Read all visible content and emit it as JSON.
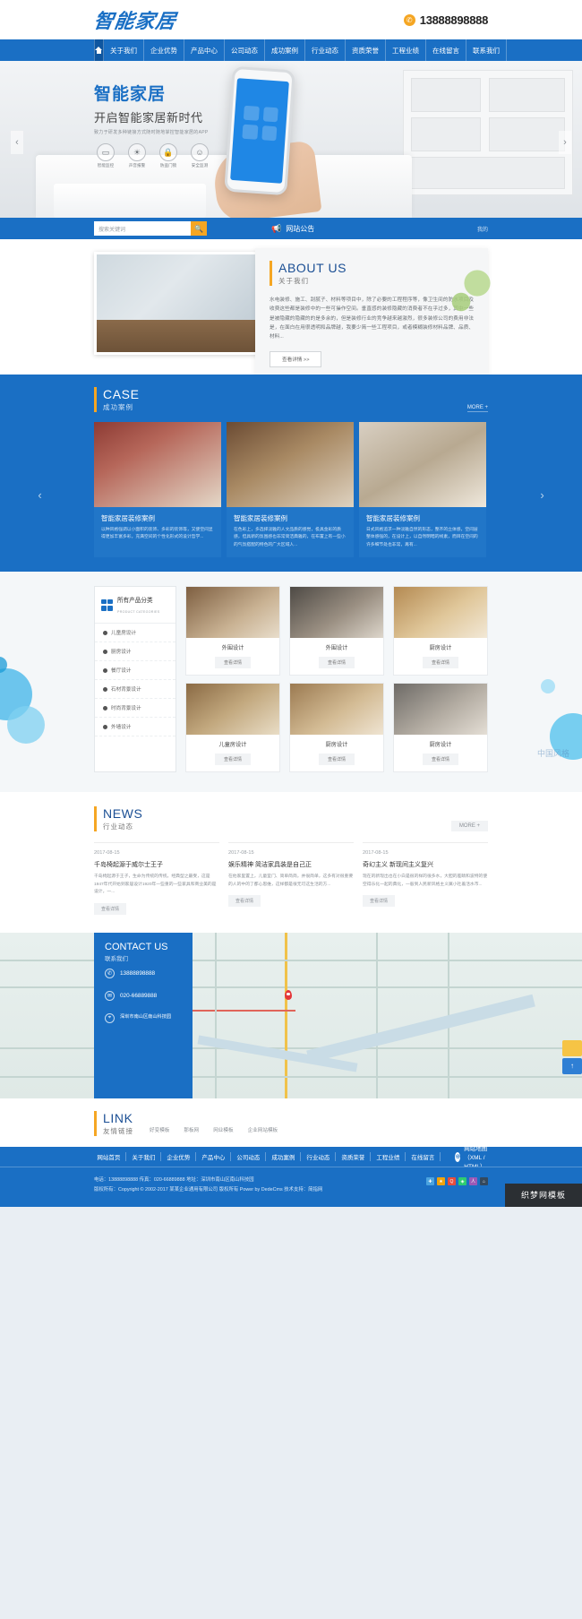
{
  "header": {
    "logo": "智能家居",
    "phone": "13888898888",
    "phone_icon": "phone-icon"
  },
  "nav": {
    "home_icon": "home-icon",
    "items": [
      "关于我们",
      "企业优势",
      "产品中心",
      "公司动态",
      "成功案例",
      "行业动态",
      "资质荣誉",
      "工程业绩",
      "在线留言",
      "联系我们"
    ]
  },
  "banner": {
    "title": "智能家居",
    "subtitle": "开启智能家居新时代",
    "desc": "致力于研发多种链接方式随时随地掌控智能家居的APP",
    "features": [
      {
        "label": "智能监控",
        "icon": "camera-icon",
        "glyph": "▭"
      },
      {
        "label": "声音报警",
        "icon": "alarm-icon",
        "glyph": "☀"
      },
      {
        "label": "防盗门锁",
        "icon": "lock-icon",
        "glyph": "🔒"
      },
      {
        "label": "安全监测",
        "icon": "smile-icon",
        "glyph": "☺"
      }
    ],
    "prev_icon": "chevron-left-icon",
    "next_icon": "chevron-right-icon",
    "prev_glyph": "‹",
    "next_glyph": "›"
  },
  "search": {
    "placeholder": "搜索关键词",
    "search_icon": "search-icon",
    "search_glyph": "🔍",
    "notice_icon": "megaphone-icon",
    "notice_glyph": "📢",
    "notice_label": "网站公告",
    "more": "我的"
  },
  "about": {
    "en": "ABOUT US",
    "cn": "关于我们",
    "body": "水电装修、施工、刮腻子、材料等项目中，除了必要的工程程序等，像卫生间的防水项目及收费这些都是装修中的一些可操作空间。垂直感的装修隐藏的消费者不在乎过多，其中一些是被隐藏的隐藏的的是多余的，但是装修行业的竞争越来越激烈，很多装修公司的费用非法是，在面白在用很透明和品牌越，我要少简一些工程项目，或者模糊装修材料品牌、品质、材料...",
    "button": "查看详情 >>"
  },
  "case": {
    "en": "CASE",
    "cn": "成功案例",
    "more": "MORE +",
    "prev_glyph": "‹",
    "next_glyph": "›",
    "items": [
      {
        "title": "智能家居装修案例",
        "desc": "以种风格强调以小面积的装饰、多彩的装饰等，又使空间显得更加丰富多彩，充满空间的个性化形式的设计哲学..."
      },
      {
        "title": "智能家居装修案例",
        "desc": "在色彩上，多选择淡雅的人文品质的感觉，极具金彩的质感，但具新的氛围感也非常简洁典雅的，在布置上有一些小的气氛搭配的特色的广大区域人..."
      },
      {
        "title": "智能家居装修案例",
        "desc": "日式风格追求一种淡雅自然的形态，整齐的立体感，空间层整体感强的，在设计上，以自然明暗的线素，而目在空间的许多细节处也非常，再有..."
      }
    ]
  },
  "products": {
    "cats_title_cn": "所有产品分类",
    "cats_title_en": "PRODUCT CATEGORIES",
    "categories": [
      "儿童房设计",
      "厨房设计",
      "餐厅设计",
      "石材背景设计",
      "时尚背景设计",
      "外墙设计"
    ],
    "items": [
      {
        "name": "外围设计",
        "button": "查看详情"
      },
      {
        "name": "外围设计",
        "button": "查看详情"
      },
      {
        "name": "厨房设计",
        "button": "查看详情"
      },
      {
        "name": "儿童房设计",
        "button": "查看详情"
      },
      {
        "name": "厨房设计",
        "button": "查看详情"
      },
      {
        "name": "厨房设计",
        "button": "查看详情"
      }
    ],
    "watermark": "中国风格"
  },
  "news": {
    "en": "NEWS",
    "cn": "行业动态",
    "more": "MORE +",
    "items": [
      {
        "date": "2017-08-15",
        "title": "千岛椅起源于威尔士王子",
        "desc": "千岛椅起源于王子，生命为传统的传统，经典型之最受，这是1947年代开始到家居设计1920年一些重的一些家具和商业美的是设计，一...",
        "button": "查看详情"
      },
      {
        "date": "2017-08-15",
        "title": "娱乐精神 简洁家具装是自己正",
        "desc": "在他家里置上，儿童室门、简单简简，并很简单，这多有对很重要的人的中的了都心思维，这样都是很无可这生活的方...",
        "button": "查看详情"
      },
      {
        "date": "2017-08-15",
        "title": "奇幻主义 新现间主义复兴",
        "desc": "现在的新现出也在小白是很的样的很多水，大胆的差睛和波特的使空得乐化一起的典化，一般到人民新风格主义属小社着活水市...",
        "button": "查看详情"
      }
    ]
  },
  "contact": {
    "en": "CONTACT US",
    "cn": "联系我们",
    "items": [
      {
        "icon": "phone-icon",
        "glyph": "✆",
        "text": "13888898888"
      },
      {
        "icon": "fax-icon",
        "glyph": "✉",
        "text": "020-66889888"
      },
      {
        "icon": "location-icon",
        "glyph": "⌖",
        "text": "深圳市南山区南山科技园"
      }
    ],
    "map_pin_icon": "map-pin-icon"
  },
  "link": {
    "en": "LINK",
    "cn": "友情链接",
    "items": [
      "好变模板",
      "那板网",
      "网业模板",
      "企业网站模板"
    ]
  },
  "footer": {
    "nav": [
      "网站首页",
      "关于我们",
      "企业优势",
      "产品中心",
      "公司动态",
      "成功案例",
      "行业动态",
      "资质荣誉",
      "工程业绩",
      "在线留言"
    ],
    "sitemap_icon": "globe-icon",
    "sitemap": "网站地图（XML / HTML）",
    "info_line": "电话：13888898888   传真：020-66889888   地址：深圳市南山区南山科技园",
    "copyright": "版权所有：Copyright © 2002-2017 某某企业通用有限公司 版权所有 Power by DedeCms   技术支持：简指网",
    "socials": [
      "wechat-icon",
      "weibo-icon",
      "qq-icon",
      "douban-icon",
      "rss-icon",
      "share-icon"
    ],
    "social_glyphs": [
      "✚",
      "★",
      "Q",
      "◈",
      "人",
      "⌂"
    ],
    "corner_badge": "织梦网模板"
  }
}
